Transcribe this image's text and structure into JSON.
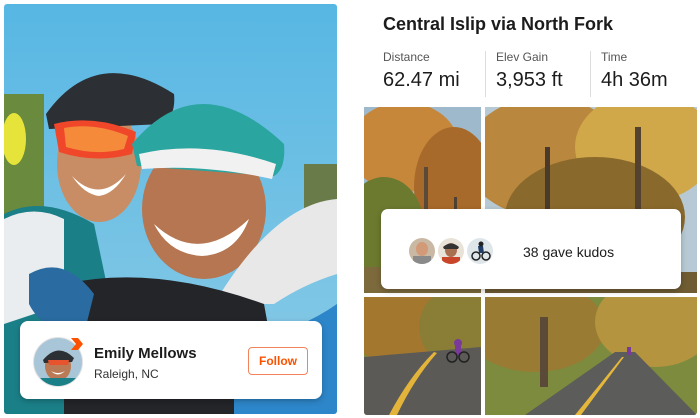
{
  "profile": {
    "name": "Emily Mellows",
    "location": "Raleigh, NC",
    "follow_label": "Follow",
    "badge_icon": "strava-chevron-icon",
    "accent_color": "#fc5200"
  },
  "activity": {
    "title": "Central Islip via North Fork",
    "stats": [
      {
        "label": "Distance",
        "value": "62.47 mi"
      },
      {
        "label": "Elev Gain",
        "value": "3,953 ft"
      },
      {
        "label": "Time",
        "value": "4h 36m"
      }
    ],
    "kudos_text": "38 gave kudos"
  }
}
